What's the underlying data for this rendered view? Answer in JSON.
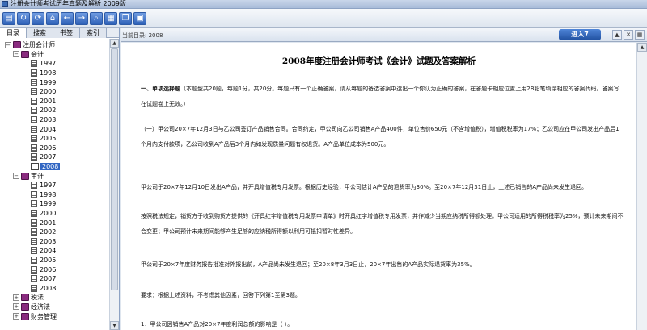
{
  "window": {
    "title": "注册会计师考试历年真题及解析  2009版"
  },
  "toolbar": {
    "buttons": [
      {
        "icon": "book-icon",
        "glyph": "▤"
      },
      {
        "icon": "refresh-icon",
        "glyph": "↻"
      },
      {
        "icon": "reload-icon",
        "glyph": "⟳"
      },
      {
        "icon": "home-icon",
        "glyph": "⌂"
      },
      {
        "icon": "back-icon",
        "glyph": "←"
      },
      {
        "icon": "forward-icon",
        "glyph": "→"
      },
      {
        "icon": "search-icon",
        "glyph": "⌕"
      },
      {
        "icon": "notes-icon",
        "glyph": "▦"
      },
      {
        "icon": "copy-icon",
        "glyph": "❐"
      },
      {
        "icon": "print-icon",
        "glyph": "▣"
      }
    ]
  },
  "sidebar": {
    "tabs": [
      "目录",
      "搜索",
      "书签",
      "索引"
    ],
    "tree": {
      "root": "注册会计师",
      "subject1": "会计",
      "years1": [
        "1997",
        "1998",
        "1999",
        "2000",
        "2001",
        "2002",
        "2003",
        "2004",
        "2005",
        "2006",
        "2007"
      ],
      "selected": "2008",
      "subject2": "审计",
      "years2": [
        "1997",
        "1998",
        "1999",
        "2000",
        "2001",
        "2002",
        "2003",
        "2004",
        "2005",
        "2006",
        "2007",
        "2008"
      ],
      "subject3": "税法",
      "subject4": "经济法",
      "subject5": "财务管理"
    }
  },
  "navbar": {
    "current_dir": "当前目录: 2008",
    "enter_label": "进入7"
  },
  "document": {
    "title": "2008年度注册会计师考试《会计》试题及答案解析",
    "section_heading": "一、单项选择题",
    "section_text": "（本题型共20题，每题1分，共20分。每题只有一个正确答案，请从每题的备选答案中选出一个你认为正确的答案，在答题卡相应位置上用2B铅笔填涂相应的答案代码。答案写在试题卷上无效。）",
    "p1": "（一）甲公司20×7年12月3日与乙公司签订产品销售合同。合同约定，甲公司向乙公司销售A产品400件，单位售价650元（不含增值税），增值税税率为17%；乙公司应在甲公司发出产品后1个月内支付款项，乙公司收到A产品后3个月内如发现质量问题有权退货。A产品单位成本为500元。",
    "p2": "甲公司于20×7年12月10日发出A产品，并开具增值税专用发票。根据历史经验，甲公司估计A产品的退货率为30%。至20×7年12月31日止，上述已销售的A产品尚未发生退回。",
    "p3": "按照税法规定，销货方于收到购货方提供的《开具红字增值税专用发票申请单》时开具红字增值税专用发票，并作减少当期应纳税所得额处理。甲公司适用的所得税税率为25%，预计未来期间不会变更；甲公司预计未来期间能够产生足够的应纳税所得额以利用可抵扣暂时性差异。",
    "p4": "甲公司于20×7年度财务报告批准对外报出前，A产品尚未发生退回；至20×8年3月3日止，20×7年出售的A产品实际退货率为35%。",
    "p5": "要求：根据上述资料，不考虑其他因素，回答下列第1至第3题。",
    "p6": "1．甲公司因销售A产品对20×7年度利润总额的影响是（ ）。"
  }
}
